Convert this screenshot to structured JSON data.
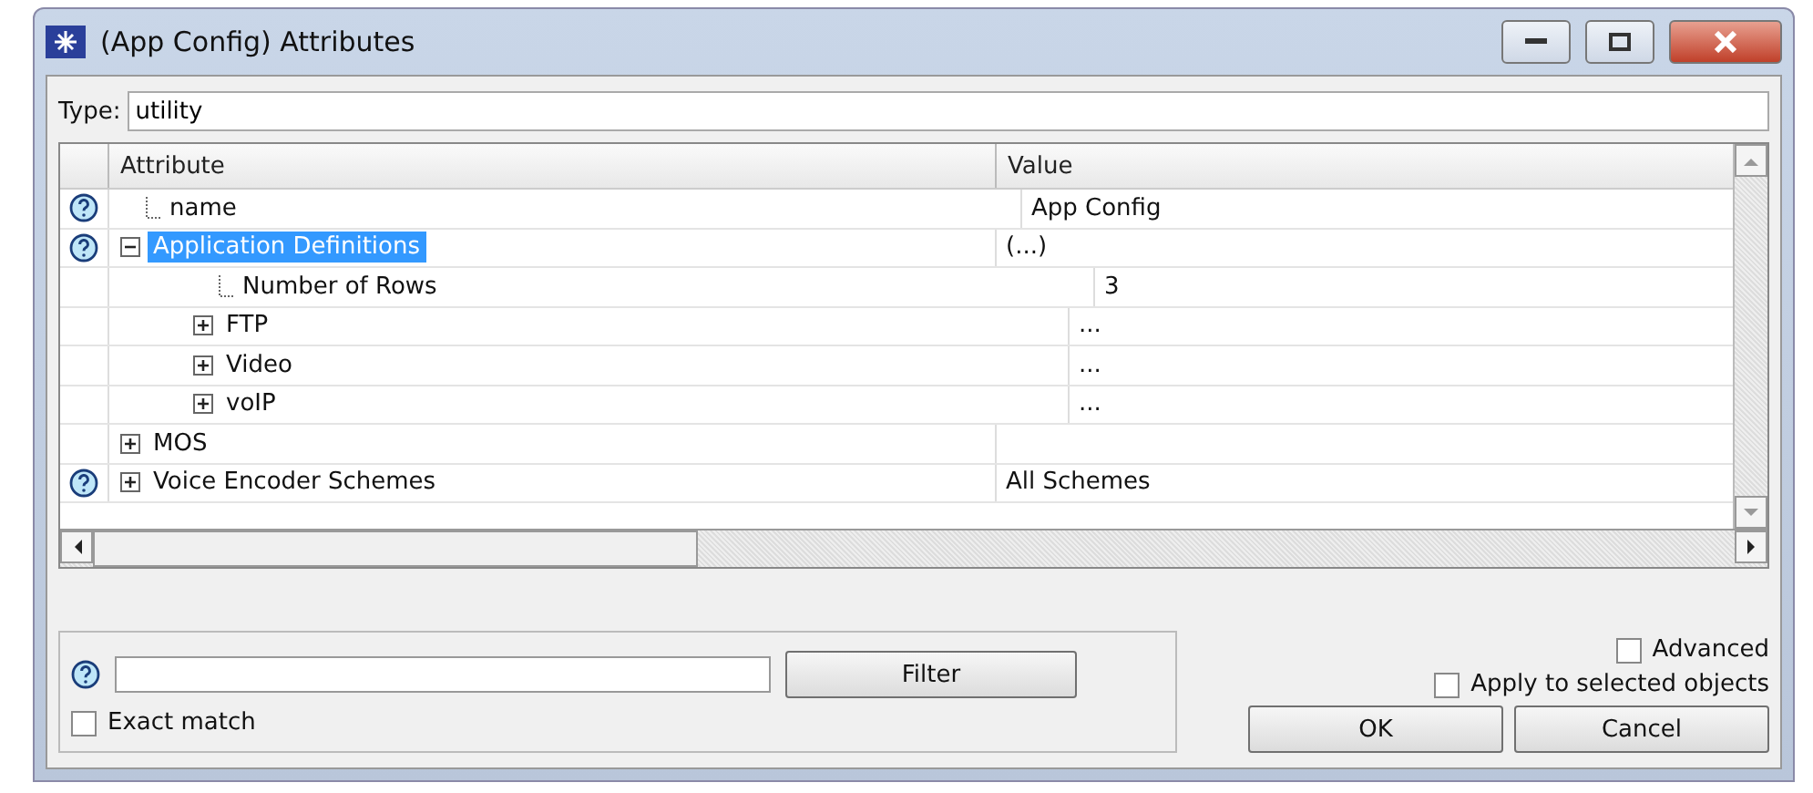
{
  "window": {
    "title": "(App Config) Attributes"
  },
  "type": {
    "label": "Type:",
    "value": "utility"
  },
  "table": {
    "columns": [
      "Attribute",
      "Value"
    ],
    "rows": [
      {
        "name": "name",
        "value": "App Config",
        "help": true,
        "kind": "leaf",
        "selected": false
      },
      {
        "name": "Application Definitions",
        "value": "(...)",
        "help": true,
        "kind": "group",
        "expanded": true,
        "selected": true,
        "children": [
          {
            "name": "Number of Rows",
            "value": "3",
            "help": false,
            "kind": "leaf",
            "selected": false
          },
          {
            "name": "FTP",
            "value": "...",
            "help": false,
            "kind": "group",
            "expanded": false,
            "selected": false
          },
          {
            "name": "Video",
            "value": "...",
            "help": false,
            "kind": "group",
            "expanded": false,
            "selected": false
          },
          {
            "name": "voIP",
            "value": "...",
            "help": false,
            "kind": "group",
            "expanded": false,
            "selected": false
          }
        ]
      },
      {
        "name": "MOS",
        "help": false,
        "kind": "group",
        "expanded": false,
        "selected": false
      },
      {
        "name": "Voice Encoder Schemes",
        "value": "All Schemes",
        "help": true,
        "kind": "group",
        "expanded": false,
        "selected": false
      }
    ]
  },
  "filter": {
    "button": {
      "label": "Filter"
    },
    "exact_match": {
      "label": "Exact match",
      "checked": false
    }
  },
  "advanced": {
    "label": "Advanced",
    "checked": false
  },
  "apply_selected": {
    "label": "Apply to selected objects",
    "checked": false
  },
  "buttons": [
    {
      "label": "OK"
    },
    {
      "label": "Cancel"
    }
  ]
}
